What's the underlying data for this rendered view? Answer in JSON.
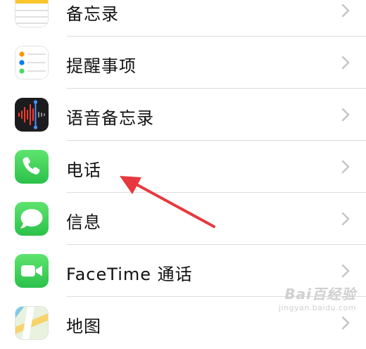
{
  "settings_list": {
    "items": [
      {
        "label": "备忘录",
        "icon": "notes-icon"
      },
      {
        "label": "提醒事项",
        "icon": "reminders-icon"
      },
      {
        "label": "语音备忘录",
        "icon": "voice-memos-icon"
      },
      {
        "label": "电话",
        "icon": "phone-icon"
      },
      {
        "label": "信息",
        "icon": "messages-icon"
      },
      {
        "label": "FaceTime 通话",
        "icon": "facetime-icon"
      },
      {
        "label": "地图",
        "icon": "maps-icon"
      }
    ]
  },
  "annotation": {
    "arrow_color": "#e8383d",
    "points_to": "电话"
  },
  "watermark": {
    "brand": "Bai百经验",
    "url": "jingyan.baidu.com"
  },
  "colors": {
    "phone_green": "#34c759",
    "messages_green": "#34c759",
    "notes_yellow": "#f9c52d",
    "separator": "#dcdce0",
    "chevron": "#c4c4c7"
  }
}
